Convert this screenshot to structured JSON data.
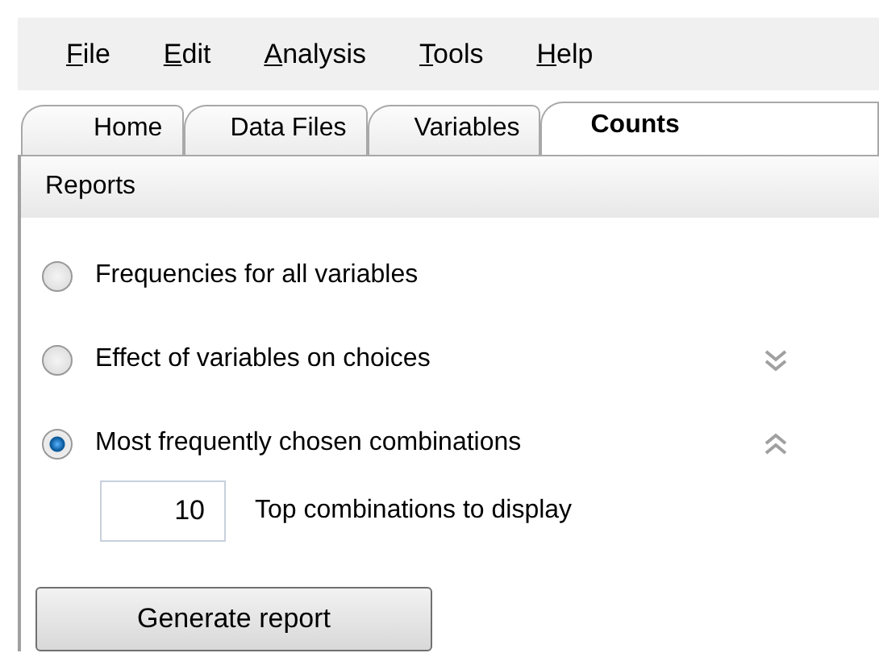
{
  "menu": [
    {
      "label": "File"
    },
    {
      "label": "Edit"
    },
    {
      "label": "Analysis"
    },
    {
      "label": "Tools"
    },
    {
      "label": "Help"
    }
  ],
  "tabs": [
    {
      "label": "Home",
      "selected": false
    },
    {
      "label": "Data Files",
      "selected": false
    },
    {
      "label": "Variables",
      "selected": false
    },
    {
      "label": "Counts",
      "selected": true
    }
  ],
  "section": {
    "title": "Reports"
  },
  "options": [
    {
      "label": "Frequencies for all variables",
      "selected": false
    },
    {
      "label": "Effect of variables on choices",
      "selected": false,
      "expander": {
        "expanded": false
      }
    },
    {
      "label": "Most frequently chosen combinations",
      "selected": true,
      "expander": {
        "expanded": true
      }
    }
  ],
  "top_count": {
    "value": "10",
    "label": "Top combinations to display"
  },
  "buttons": [
    "Generate report"
  ]
}
